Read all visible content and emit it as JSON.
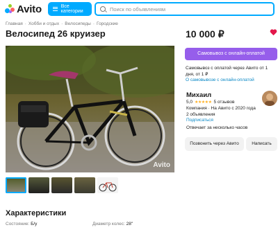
{
  "header": {
    "logo_text": "Avito",
    "categories_label": "Все категории",
    "search_placeholder": "Поиск по объявлениям"
  },
  "breadcrumbs": [
    "Главная",
    "Хобби и отдых",
    "Велосипеды",
    "Городские"
  ],
  "title": "Велосипед 26 круизер",
  "price": "10 000 ₽",
  "photo": {
    "watermark": "Avito",
    "thumbnail_count": 5
  },
  "buy_button": "Самовывоз с онлайн-оплатой",
  "delivery_info": "Самовывоз с оплатой через Авито от 1 дня, от 1 ₽",
  "delivery_link": "О самовывозе с онлайн-оплатой",
  "seller": {
    "name": "Михаил",
    "rating": "5,0",
    "stars": 5,
    "reviews": "5 отзывов",
    "type_since": "Компания · На Авито с 2020 года",
    "listings": "2 объявления",
    "subscribe": "Подписаться",
    "response": "Отвечает за несколько часов"
  },
  "buttons": {
    "call": "Позвонить через Авито",
    "write": "Написать"
  },
  "characteristics": {
    "title": "Характеристики",
    "items": [
      {
        "label": "Состояние:",
        "value": "Б/у"
      },
      {
        "label": "Диаметр колес:",
        "value": "28\""
      }
    ]
  },
  "colors": {
    "accent": "#00aaff",
    "buy": "#965eeb",
    "link": "#0a88c6",
    "star": "#ffb021",
    "heart": "#e3174b"
  }
}
